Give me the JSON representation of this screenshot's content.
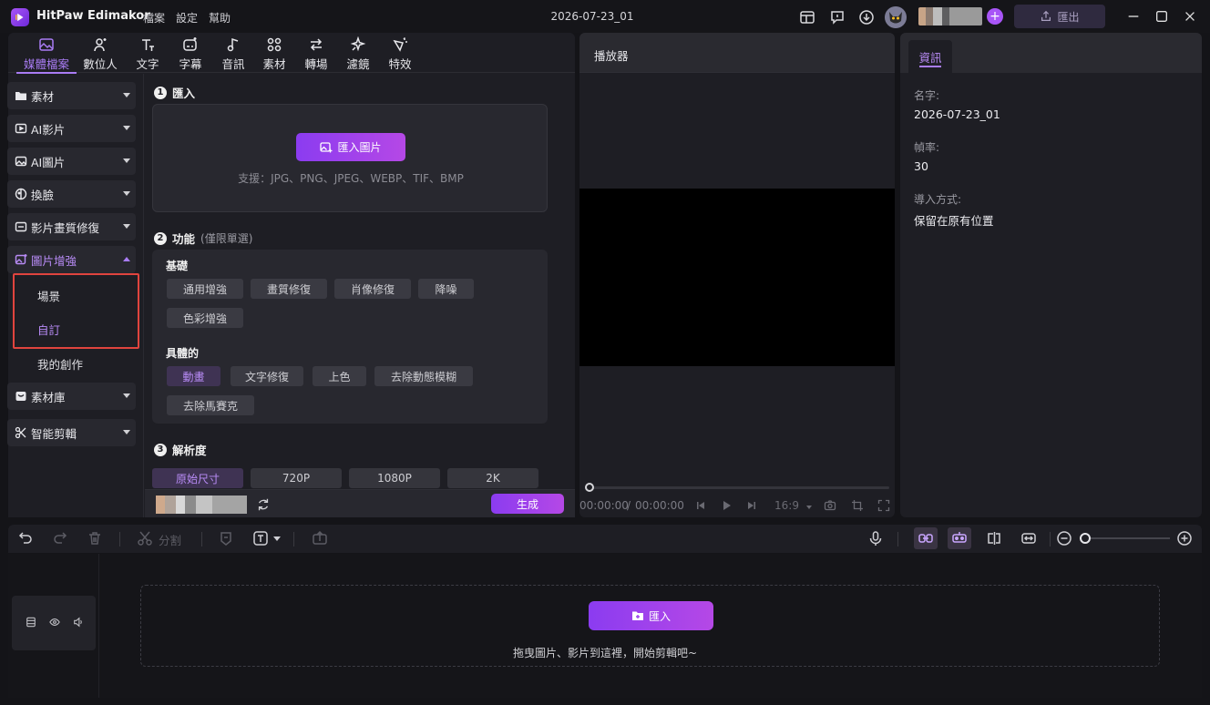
{
  "app": {
    "name": "HitPaw Edimakor",
    "menus": [
      "檔案",
      "設定",
      "幫助"
    ],
    "project_title": "2026-07-23_01",
    "export_label": "匯出"
  },
  "toolbar": {
    "tabs": [
      "媒體檔案",
      "數位人",
      "文字",
      "字幕",
      "音訊",
      "素材",
      "轉場",
      "濾鏡",
      "特效"
    ]
  },
  "sidebar": {
    "items": [
      "素材",
      "AI影片",
      "AI圖片",
      "換臉",
      "影片畫質修復",
      "圖片增強"
    ],
    "sub_items": [
      "場景",
      "自訂",
      "我的創作"
    ],
    "items2": [
      "素材庫",
      "智能剪輯"
    ]
  },
  "import_section": {
    "number": "1",
    "title": "匯入",
    "button_label": "匯入圖片",
    "support_text": "支援：JPG、PNG、JPEG、WEBP、TIF、BMP"
  },
  "function_section": {
    "number": "2",
    "title": "功能",
    "hint": "(僅限單選)",
    "basic_title": "基礎",
    "basic_options": [
      "通用增強",
      "畫質修復",
      "肖像修復",
      "降噪",
      "色彩增強"
    ],
    "specific_title": "具體的",
    "specific_options": [
      "動畫",
      "文字修復",
      "上色",
      "去除動態模糊",
      "去除馬賽克"
    ],
    "selected": "動畫"
  },
  "resolution_section": {
    "number": "3",
    "title": "解析度",
    "options": [
      "原始尺寸",
      "720P",
      "1080P",
      "2K"
    ],
    "selected": "原始尺寸"
  },
  "generate_label": "生成",
  "player": {
    "title": "播放器",
    "current_time": "00:00:00",
    "separator": "/",
    "total_time": "00:00:00",
    "aspect_ratio": "16:9"
  },
  "info": {
    "tab_label": "資訊",
    "name_label": "名字:",
    "name_value": "2026-07-23_01",
    "fps_label": "幀率:",
    "fps_value": "30",
    "import_mode_label": "導入方式:",
    "import_mode_value": "保留在原有位置"
  },
  "timeline": {
    "split_label": "分割",
    "import_label": "匯入",
    "drop_text": "拖曳圖片、影片到這裡，開始剪輯吧~"
  },
  "colors": {
    "accent": "#a97cf4",
    "button_gradient_start": "#8b3cf0",
    "button_gradient_end": "#b548e6",
    "highlight_box": "#e0443e"
  }
}
